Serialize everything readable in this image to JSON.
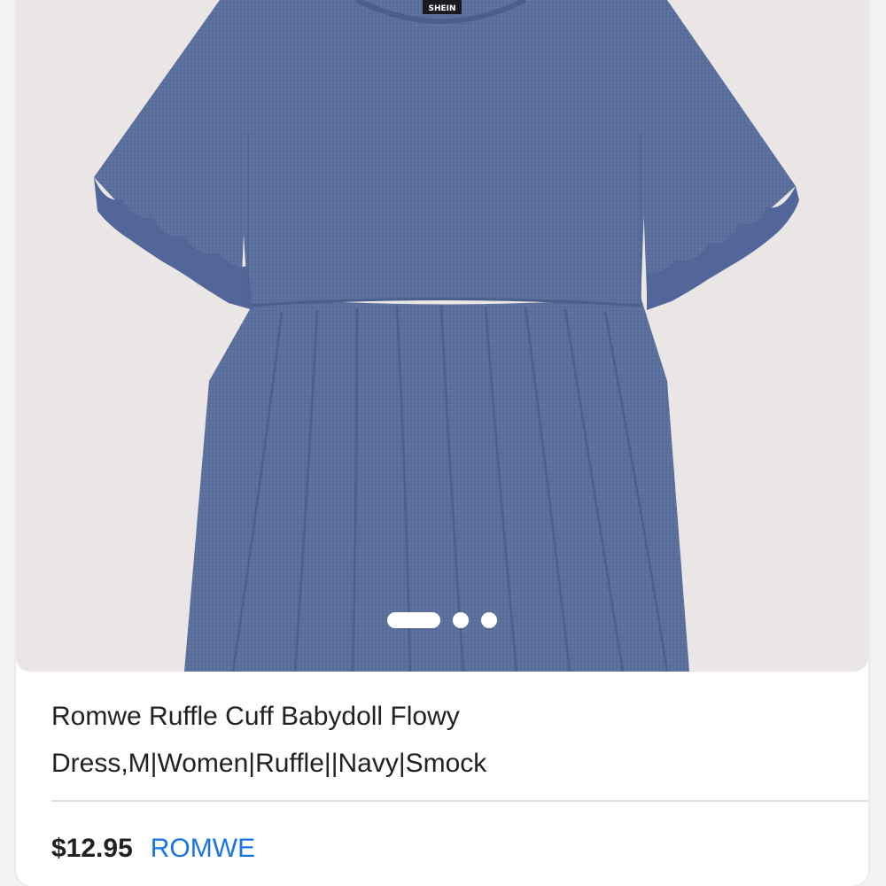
{
  "product": {
    "image": {
      "subject": "dress-photo",
      "brand_tag": "SHEIN",
      "colors": {
        "background": "#eae6e5",
        "fabric": "#5a6f9c",
        "fabric_shadow": "#4b5f8b"
      }
    },
    "carousel": {
      "count": 3,
      "active_index": 0
    },
    "title_line1": "Romwe Ruffle Cuff Babydoll Flowy",
    "title_line2": "Dress,M|Women|Ruffle||Navy|Smock",
    "price": "$12.95",
    "seller": "ROMWE",
    "colors": {
      "price": "#202124",
      "seller_link": "#1a73e8"
    }
  }
}
